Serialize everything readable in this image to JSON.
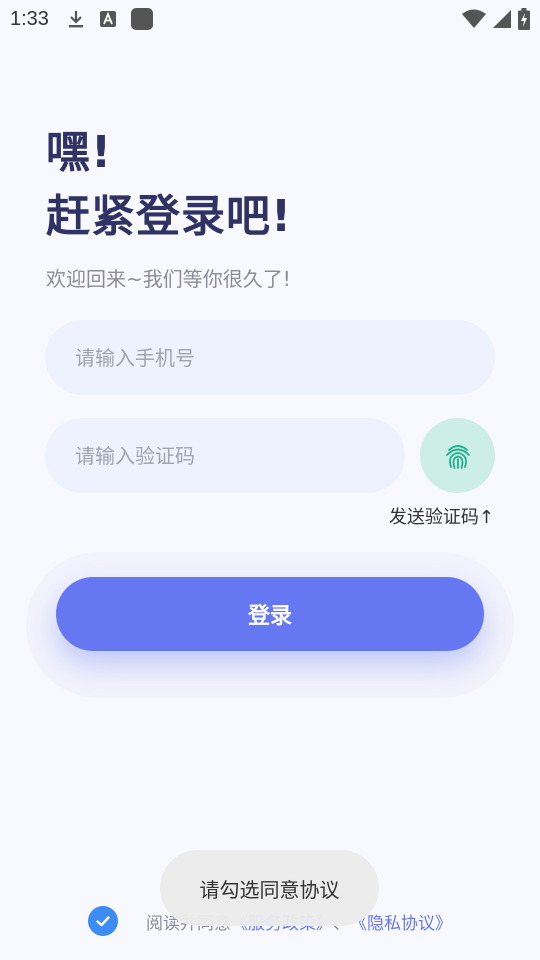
{
  "status_bar": {
    "time": "1:33",
    "icons": [
      "download-icon",
      "a-letter-icon",
      "app-square-icon",
      "wifi-icon",
      "signal-icon",
      "battery-charging-icon"
    ]
  },
  "heading": {
    "line1": "嘿!",
    "line2": "赶紧登录吧!"
  },
  "subtitle": "欢迎回来~我们等你很久了!",
  "phone_input": {
    "placeholder": "请输入手机号",
    "value": ""
  },
  "code_input": {
    "placeholder": "请输入验证码",
    "value": ""
  },
  "send_code_label": "发送验证码↑",
  "login_label": "登录",
  "agreement": {
    "prefix": "阅读并同意",
    "service_link": "《服务政策》",
    "separator": "、",
    "privacy_link": "《隐私协议》"
  },
  "toast": "请勾选同意协议",
  "colors": {
    "accent": "#6677f2",
    "fingerprint_bg": "#cdeee6",
    "fingerprint_icon": "#1fae8f",
    "checkbox": "#3d8cf5",
    "input_bg": "#eef2ff"
  }
}
